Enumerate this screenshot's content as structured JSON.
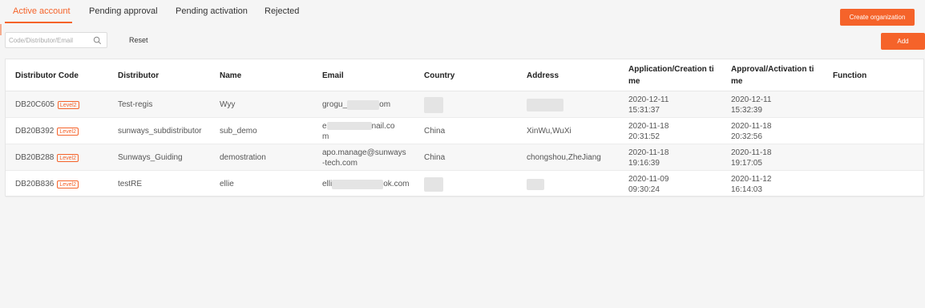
{
  "tabs": [
    {
      "label": "Active account",
      "active": true
    },
    {
      "label": "Pending approval",
      "active": false
    },
    {
      "label": "Pending activation",
      "active": false
    },
    {
      "label": "Rejected",
      "active": false
    }
  ],
  "actions": {
    "create_org": "Create organization",
    "add": "Add"
  },
  "search": {
    "placeholder": "Code/Distributor/Email",
    "reset": "Reset"
  },
  "table": {
    "headers": [
      "Distributor Code",
      "Distributor",
      "Name",
      "Email",
      "Country",
      "Address",
      "Application/Creation ti\nme",
      "Approval/Activation ti\nme",
      "Function"
    ],
    "rows": [
      {
        "code": "DB20C605",
        "badge": "Level2",
        "distributor": "Test-regis",
        "name": "Wyy",
        "email": [
          "grogu_",
          "om"
        ],
        "country": "",
        "address": "",
        "app_date": "2020-12-11",
        "app_time": "15:31:37",
        "appr_date": "2020-12-11",
        "appr_time": "15:32:39"
      },
      {
        "code": "DB20B392",
        "badge": "Level2",
        "distributor": "sunways_subdistributor",
        "name": "sub_demo",
        "email": [
          "e",
          "nail.co",
          "m"
        ],
        "country": "China",
        "address": "XinWu,WuXi",
        "app_date": "2020-11-18",
        "app_time": "20:31:52",
        "appr_date": "2020-11-18",
        "appr_time": "20:32:56"
      },
      {
        "code": "DB20B288",
        "badge": "Level2",
        "distributor": "Sunways_Guiding",
        "name": "demostration",
        "email": [
          "apo.manage@sunways",
          "-tech.com"
        ],
        "country": "China",
        "address": "chongshou,ZheJiang",
        "app_date": "2020-11-18",
        "app_time": "19:16:39",
        "appr_date": "2020-11-18",
        "appr_time": "19:17:05"
      },
      {
        "code": "DB20B836",
        "badge": "Level2",
        "distributor": "testRE",
        "name": "ellie",
        "email": [
          "elli",
          "ok.com"
        ],
        "country": "",
        "address": "",
        "app_date": "2020-11-09",
        "app_time": "09:30:24",
        "appr_date": "2020-11-12",
        "appr_time": "16:14:03"
      }
    ]
  },
  "icons": {
    "search": "search-icon"
  },
  "colors": {
    "accent": "#f5632a"
  }
}
